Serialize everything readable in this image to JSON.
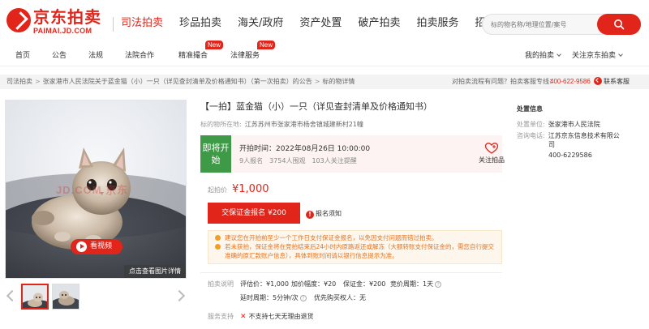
{
  "logo": {
    "cn": "京东拍卖",
    "en": "PAIMAI.JD.COM"
  },
  "main_nav": [
    "司法拍卖",
    "珍品拍卖",
    "海关/政府",
    "资产处置",
    "破产拍卖",
    "拍卖服务",
    "招标采购"
  ],
  "search": {
    "placeholder": "标的物名称/地理位置/案号"
  },
  "sub_nav": {
    "home": "首页",
    "notice": "公告",
    "law": "法规",
    "cooperation": "法院合作",
    "match": "精准撮合",
    "legal_service": "法律服务",
    "new_badge": "New",
    "my_auction": "我的拍卖",
    "follow_jd": "关注京东拍卖"
  },
  "breadcrumb": [
    "司法拍卖",
    "张家港市人民法院关于蓝金猫（小）一只（详见查封清单及价格通知书）（第一次拍卖）的公告",
    "标的物详情"
  ],
  "help": {
    "question": "对拍卖流程有问题？拍卖客服专线：",
    "phone": "400-622-9586",
    "contact": "联系客服"
  },
  "gallery": {
    "video_label": "看视频",
    "detail_link": "点击查看图片详情",
    "watermark": "JD.COM 京东"
  },
  "item": {
    "title": "【一拍】蓝金猫（小）一只（详见查封清单及价格通知书）",
    "location_label": "标的物所在地:",
    "location_value": "江苏苏州市张家港市杨舍镇城建新村21幢",
    "status": "即将开始",
    "start_time": "开拍时间：2022年08月26日 10:00:00",
    "signups": "9人报名",
    "views": "3754人围观",
    "reminders": "103人关注提醒",
    "follow_label": "关注拍品",
    "start_price_label": "起拍价",
    "start_price": "¥1,000",
    "deposit_button": "交保证金报名 ¥200",
    "notice_link": "报名须知",
    "tips": [
      "建议您在开拍前至少一个工作日支付保证金报名，以免因支付问题而错过拍卖。",
      "若未获拍，保证金将在竞拍结束后24小时内原路返还或解冻（大额转账支付保证金的，需您自行提交准确的原汇款账户信息），具体到账时间请以银行信息提示为准。"
    ]
  },
  "auction_desc": {
    "label": "拍卖说明",
    "appraisal": "评估价：¥1,000",
    "increment": "加价幅度：¥20",
    "deposit": "保证金：¥200",
    "period": "竞价周期：1天",
    "delay": "延时周期：5分钟/次",
    "priority": "优先购买权人：无"
  },
  "service": {
    "label": "服务支持",
    "no_return": "不支持七天无理由退货"
  },
  "disposal": {
    "heading": "处置信息",
    "unit_label": "处置单位:",
    "unit_value": "张家港市人民法院",
    "consult_label": "咨询电话:",
    "consult_company_1": "江苏京东信息技术有限公",
    "consult_company_2": "司",
    "consult_phone": "400-6229586"
  },
  "colors": {
    "brand": "#e1251b",
    "status_green": "#3f9a48",
    "tip_orange": "#e57421"
  },
  "icons": [
    "search-icon",
    "heart-plus-icon",
    "play-icon",
    "headset-icon",
    "question-icon",
    "close-x-icon",
    "bulb-icon"
  ]
}
